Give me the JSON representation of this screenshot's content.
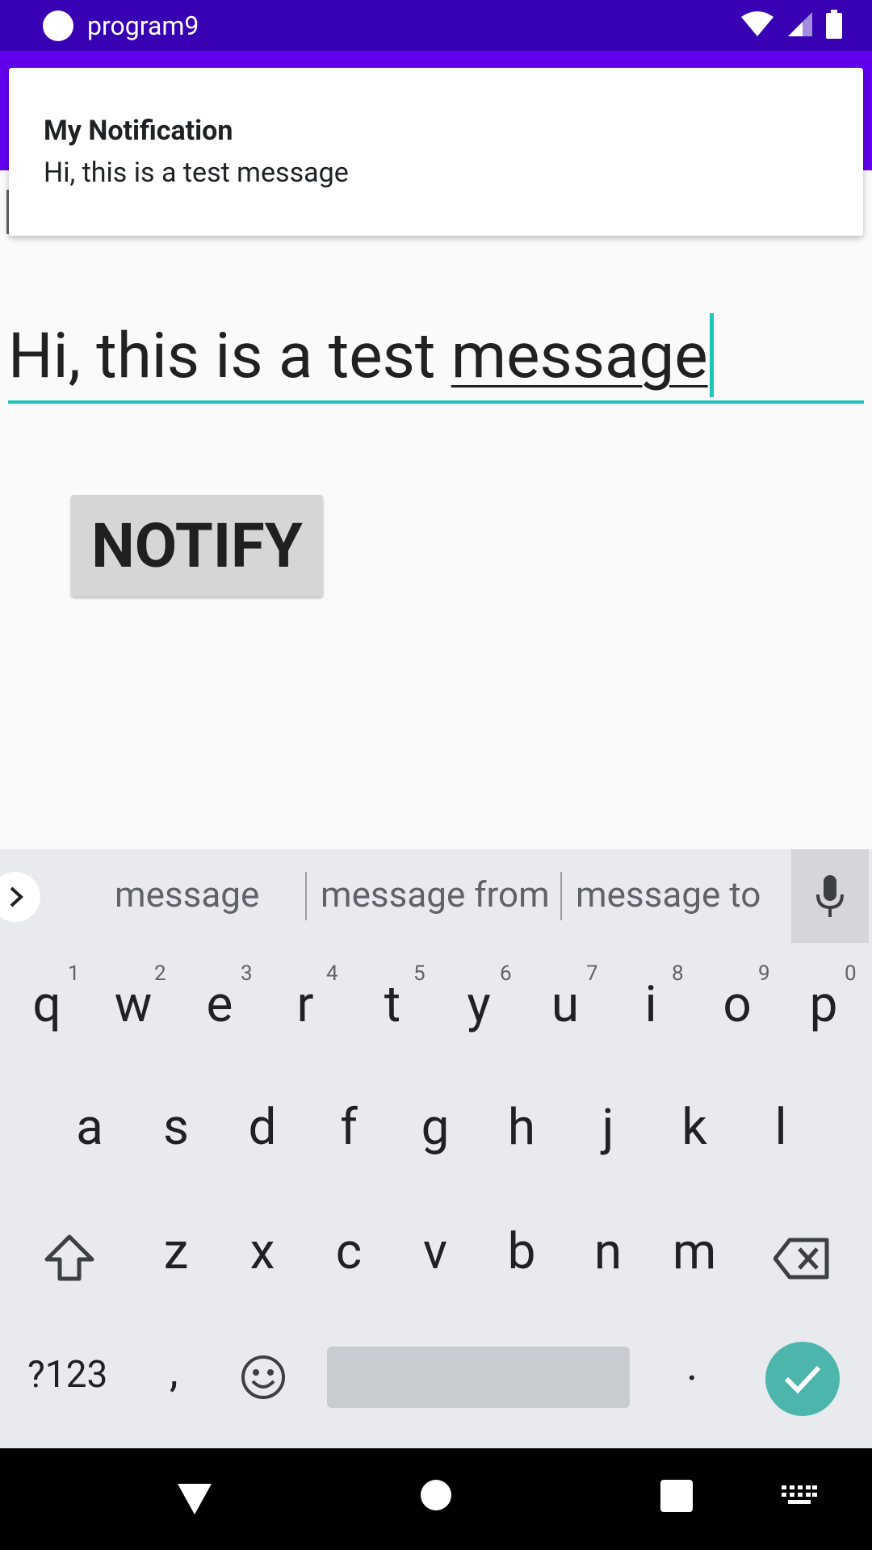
{
  "status_bar": {
    "app_name": "program9"
  },
  "background_label_partial": "message",
  "notification": {
    "title": "My Notification",
    "text": "Hi, this is a test message"
  },
  "edit_text": {
    "value_prefix": "Hi, this is a test ",
    "value_last_word": "message",
    "accent_color": "#1ec4b8"
  },
  "notify_button": {
    "label": "NOTIFY"
  },
  "keyboard": {
    "suggestions": [
      "message",
      "message from",
      "message to"
    ],
    "row1": [
      {
        "key": "q",
        "hint": "1"
      },
      {
        "key": "w",
        "hint": "2"
      },
      {
        "key": "e",
        "hint": "3"
      },
      {
        "key": "r",
        "hint": "4"
      },
      {
        "key": "t",
        "hint": "5"
      },
      {
        "key": "y",
        "hint": "6"
      },
      {
        "key": "u",
        "hint": "7"
      },
      {
        "key": "i",
        "hint": "8"
      },
      {
        "key": "o",
        "hint": "9"
      },
      {
        "key": "p",
        "hint": "0"
      }
    ],
    "row2": [
      "a",
      "s",
      "d",
      "f",
      "g",
      "h",
      "j",
      "k",
      "l"
    ],
    "row3": [
      "z",
      "x",
      "c",
      "v",
      "b",
      "n",
      "m"
    ],
    "symbols_label": "?123",
    "comma": ",",
    "period": ".",
    "icons": [
      "shift-icon",
      "backspace-icon",
      "emoji-icon",
      "mic-icon",
      "check-icon",
      "chevron-right-icon"
    ]
  },
  "nav_bar": {
    "icons": [
      "back-icon",
      "home-icon",
      "recents-icon",
      "keyboard-switch-icon"
    ]
  }
}
